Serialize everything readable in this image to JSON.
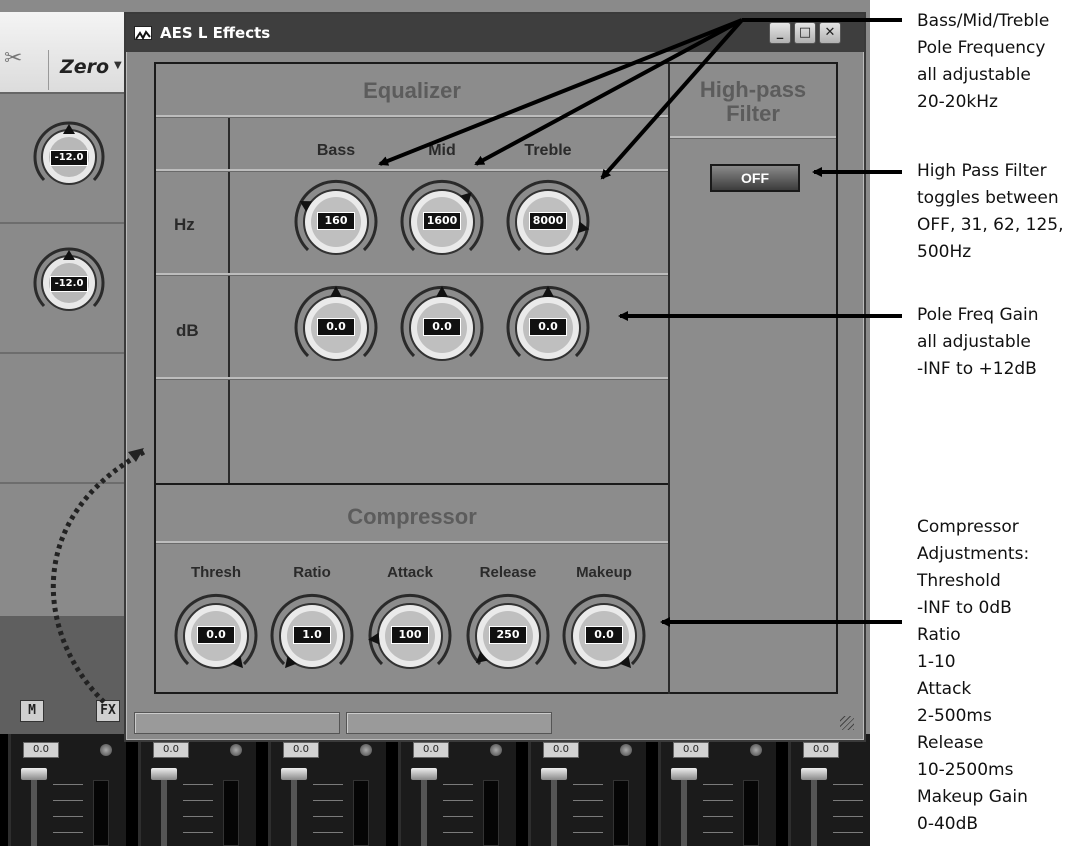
{
  "background_app": {
    "toolbar": {
      "tool_icon": "wrench-screwdriver-icon",
      "preset_label": "Zero"
    },
    "channel_knobs": [
      "-12.0",
      "-12.0"
    ],
    "buttons": {
      "mute_label": "M",
      "fx_label": "FX"
    },
    "channel_strips": [
      {
        "value": "0.0"
      },
      {
        "value": "0.0"
      },
      {
        "value": "0.0"
      },
      {
        "value": "0.0"
      },
      {
        "value": "0.0"
      },
      {
        "value": "0.0"
      },
      {
        "value": "0.0"
      }
    ]
  },
  "window": {
    "title": "AES L Effects",
    "controls": {
      "minimize": "_",
      "maximize": "□",
      "close": "✕"
    }
  },
  "equalizer": {
    "title": "Equalizer",
    "columns": [
      "Bass",
      "Mid",
      "Treble"
    ],
    "rows": [
      "Hz",
      "dB"
    ],
    "hz_values": [
      "160",
      "1600",
      "8000"
    ],
    "db_values": [
      "0.0",
      "0.0",
      "0.0"
    ]
  },
  "highpass": {
    "title_line1": "High-pass",
    "title_line2": "Filter",
    "button_label": "OFF"
  },
  "compressor": {
    "title": "Compressor",
    "labels": [
      "Thresh",
      "Ratio",
      "Attack",
      "Release",
      "Makeup"
    ],
    "values": [
      "0.0",
      "1.0",
      "100",
      "250",
      "0.0"
    ]
  },
  "annotations": {
    "pole_frequency": [
      "Bass/Mid/Treble",
      "Pole Frequency",
      "all adjustable",
      "20-20kHz"
    ],
    "high_pass": [
      "High Pass Filter",
      "toggles between",
      "OFF,  31, 62, 125,",
      "500Hz"
    ],
    "gain": [
      "Pole Freq Gain",
      "all adjustable",
      "-INF to +12dB"
    ],
    "compressor": [
      "Compressor",
      "Adjustments:",
      "Threshold",
      "-INF to 0dB",
      "Ratio",
      "1-10",
      "Attack",
      "2-500ms",
      "Release",
      "10-2500ms",
      "Makeup Gain",
      "0-40dB"
    ]
  },
  "colors": {
    "panel": "#8c8c8c",
    "titlebar": "#3e3e3e",
    "readout": "#111111"
  }
}
